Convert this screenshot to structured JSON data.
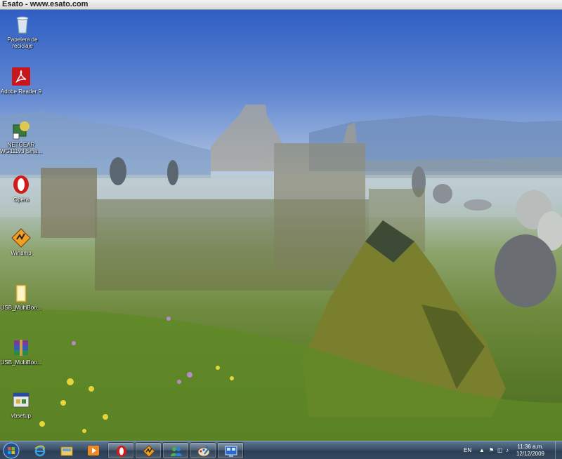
{
  "watermark": {
    "text": "Esato - www.esato.com"
  },
  "desktop": {
    "icons": [
      {
        "label": "Papelera de reciclaje",
        "icon": "recycle-bin-icon"
      },
      {
        "label": "Adobe Reader 9",
        "icon": "adobe-reader-icon"
      },
      {
        "label": "NETGEAR WG111v3 Sma...",
        "icon": "netgear-icon"
      },
      {
        "label": "Opera",
        "icon": "opera-icon"
      },
      {
        "label": "Winamp",
        "icon": "winamp-icon"
      },
      {
        "label": "USB_MultiBoo...",
        "icon": "folder-icon"
      },
      {
        "label": "USB_MultiBoo...",
        "icon": "winrar-archive-icon"
      },
      {
        "label": "vbsetup",
        "icon": "setup-icon"
      }
    ]
  },
  "taskbar": {
    "start": "windows-start-orb-icon",
    "pinned": [
      {
        "name": "internet-explorer",
        "icon": "internet-explorer-icon"
      },
      {
        "name": "windows-explorer",
        "icon": "folder-library-icon"
      },
      {
        "name": "media-player",
        "icon": "media-player-icon"
      },
      {
        "name": "opera",
        "icon": "opera-icon"
      },
      {
        "name": "winamp",
        "icon": "winamp-icon"
      },
      {
        "name": "messenger",
        "icon": "messenger-icon"
      },
      {
        "name": "paint",
        "icon": "paint-icon"
      },
      {
        "name": "network-monitor",
        "icon": "network-monitor-icon"
      }
    ],
    "tray": {
      "language": "EN",
      "time": "11:36 a.m.",
      "date": "12/12/2009"
    }
  }
}
